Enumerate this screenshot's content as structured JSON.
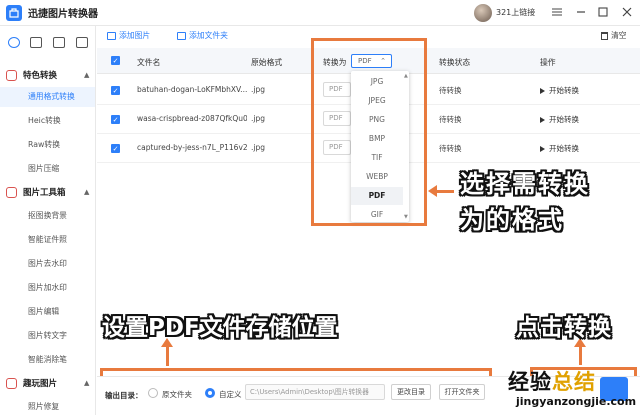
{
  "window": {
    "title": "迅捷图片转换器",
    "username": "321上链接",
    "controls": [
      "menu",
      "minimize",
      "maximize",
      "close"
    ]
  },
  "toolbar_icons": [
    "home-icon",
    "image-icon",
    "layers-icon",
    "crop-icon"
  ],
  "sidebar": {
    "groups": [
      {
        "label": "特色转换",
        "items": [
          "通用格式转换",
          "Heic转换",
          "Raw转换",
          "图片压缩"
        ]
      },
      {
        "label": "图片工具箱",
        "items": [
          "抠图换背景",
          "智能证件照",
          "图片去水印",
          "图片加水印",
          "图片编辑",
          "图片转文字",
          "智能消除笔"
        ]
      },
      {
        "label": "趣玩图片",
        "items": [
          "照片修复"
        ]
      }
    ],
    "active_item": "通用格式转换"
  },
  "actions": {
    "add_image": "添加图片",
    "add_folder": "添加文件夹",
    "clear": "清空"
  },
  "table": {
    "headers": {
      "filename": "文件名",
      "orig_format": "原始格式",
      "convert_to": "转换为",
      "status": "转换状态",
      "operation": "操作"
    },
    "rows": [
      {
        "name": "batuhan-dogan-LoKFMbhXV...",
        "format": ".jpg",
        "target": "PDF",
        "status": "待转换",
        "action": "开始转换"
      },
      {
        "name": "wasa-crispbread-z087QfkQu0...",
        "format": ".jpg",
        "target": "PDF",
        "status": "待转换",
        "action": "开始转换"
      },
      {
        "name": "captured-by-jess-n7L_P116v2...",
        "format": ".jpg",
        "target": "PDF",
        "status": "待转换",
        "action": "开始转换"
      }
    ]
  },
  "format_select": {
    "value": "PDF",
    "options": [
      "JPG",
      "JPEG",
      "PNG",
      "BMP",
      "TIF",
      "WEBP",
      "PDF",
      "GIF"
    ],
    "selected": "PDF"
  },
  "output": {
    "label": "输出目录：",
    "option_original": "原文件夹",
    "option_custom": "自定义",
    "path": "C:\\Users\\Admin\\Desktop\\图片转换器",
    "change_dir": "更改目录",
    "open_folder": "打开文件夹"
  },
  "annotations": {
    "select_format_line1": "选择需转换",
    "select_format_line2": "为的格式",
    "set_pdf_location": "设置PDF文件存储位置",
    "click_convert": "点击转换"
  },
  "watermark": {
    "cn_part1": "经验",
    "cn_part2": "总结",
    "en": "jingyanzongjie.com"
  },
  "colors": {
    "accent": "#2d7ff9",
    "highlight": "#e87a3e",
    "active_bg": "#edf4fe"
  }
}
